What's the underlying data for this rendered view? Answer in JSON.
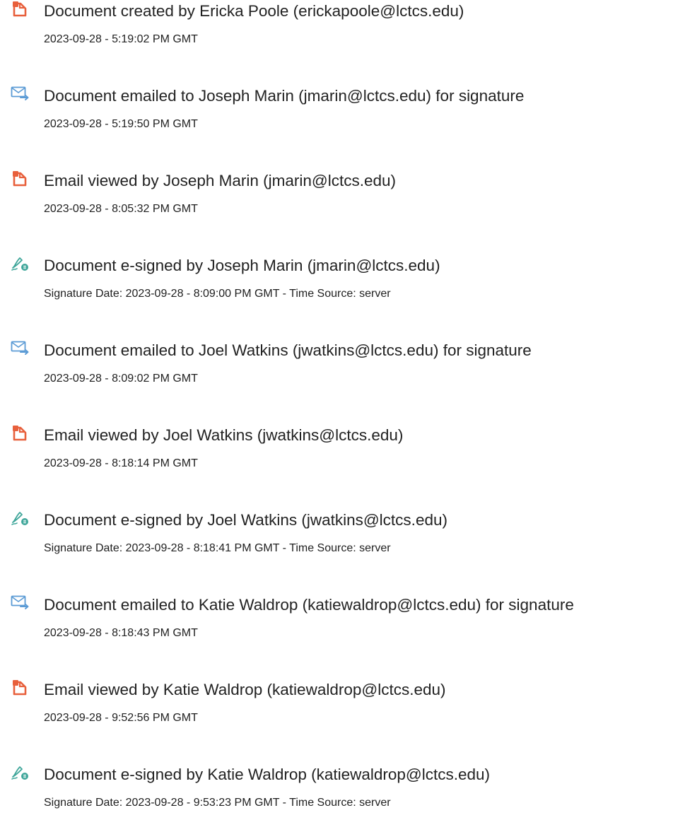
{
  "colors": {
    "doc_icon": "#e8603c",
    "email_icon": "#5b9bd5",
    "sign_icon": "#3fa69a"
  },
  "entries": [
    {
      "icon": "document-icon",
      "title": "Document created by Ericka Poole (erickapoole@lctcs.edu)",
      "detail": "2023-09-28 - 5:19:02 PM GMT"
    },
    {
      "icon": "email-icon",
      "title": "Document emailed to Joseph Marin (jmarin@lctcs.edu) for signature",
      "detail": "2023-09-28 - 5:19:50 PM GMT"
    },
    {
      "icon": "document-icon",
      "title": "Email viewed by Joseph Marin (jmarin@lctcs.edu)",
      "detail": "2023-09-28 - 8:05:32 PM GMT"
    },
    {
      "icon": "esign-icon",
      "title": "Document e-signed by Joseph Marin (jmarin@lctcs.edu)",
      "detail": "Signature Date: 2023-09-28 - 8:09:00 PM GMT - Time Source: server"
    },
    {
      "icon": "email-icon",
      "title": "Document emailed to Joel Watkins (jwatkins@lctcs.edu) for signature",
      "detail": "2023-09-28 - 8:09:02 PM GMT"
    },
    {
      "icon": "document-icon",
      "title": "Email viewed by Joel Watkins (jwatkins@lctcs.edu)",
      "detail": "2023-09-28 - 8:18:14 PM GMT"
    },
    {
      "icon": "esign-icon",
      "title": "Document e-signed by Joel Watkins (jwatkins@lctcs.edu)",
      "detail": "Signature Date: 2023-09-28 - 8:18:41 PM GMT - Time Source: server"
    },
    {
      "icon": "email-icon",
      "title": "Document emailed to Katie Waldrop (katiewaldrop@lctcs.edu) for signature",
      "detail": "2023-09-28 - 8:18:43 PM GMT"
    },
    {
      "icon": "document-icon",
      "title": "Email viewed by Katie Waldrop (katiewaldrop@lctcs.edu)",
      "detail": "2023-09-28 - 9:52:56 PM GMT"
    },
    {
      "icon": "esign-icon",
      "title": "Document e-signed by Katie Waldrop (katiewaldrop@lctcs.edu)",
      "detail": "Signature Date: 2023-09-28 - 9:53:23 PM GMT - Time Source: server"
    }
  ]
}
